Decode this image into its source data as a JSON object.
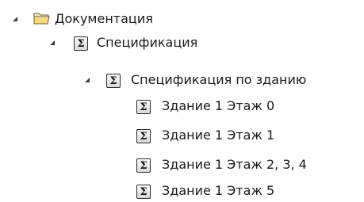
{
  "tree": {
    "root": {
      "label": "Документация",
      "icon": "folder-open-icon",
      "expanded": true,
      "children": [
        {
          "label": "Спецификация",
          "icon": "sigma-icon",
          "expanded": true,
          "children": [
            {
              "label": "Спецификация по зданию",
              "icon": "sigma-icon",
              "expanded": true,
              "children": [
                {
                  "label": "Здание 1 Этаж 0",
                  "icon": "sigma-icon"
                },
                {
                  "label": "Здание 1 Этаж 1",
                  "icon": "sigma-icon"
                },
                {
                  "label": "Здание 1 Этаж 2, 3, 4",
                  "icon": "sigma-icon"
                },
                {
                  "label": "Здание 1 Этаж 5",
                  "icon": "sigma-icon"
                }
              ]
            }
          ]
        }
      ]
    },
    "sigma_glyph": "Σ",
    "colors": {
      "folder_fill": "#f4d77a",
      "folder_stroke": "#7a6a3a",
      "text": "#1a1a1a"
    }
  }
}
